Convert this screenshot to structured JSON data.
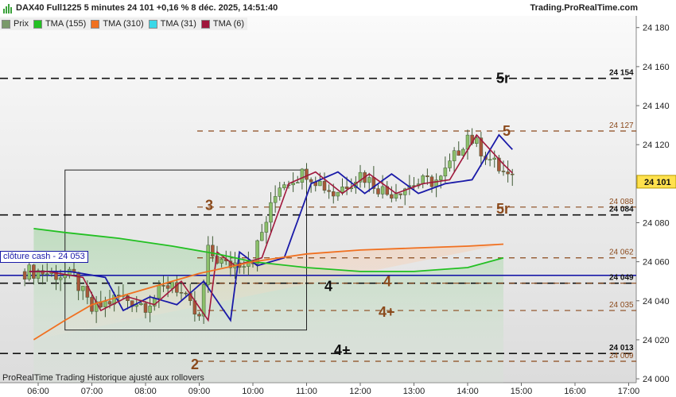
{
  "header": {
    "title": "DAX40 Full1225 5 minutes 24 101 +0,16 % 8 déc. 2025, 14:51:40",
    "site": "Trading.ProRealTime.com"
  },
  "legend": [
    {
      "label": "Prix",
      "color": "#7a9a6a"
    },
    {
      "label": "TMA (155)",
      "color": "#22c022"
    },
    {
      "label": "TMA (310)",
      "color": "#f07020"
    },
    {
      "label": "TMA (31)",
      "color": "#3ad8e8"
    },
    {
      "label": "TMA (6)",
      "color": "#a0183c"
    }
  ],
  "cash_label": "clôture cash -  24 053",
  "footer_note": "ProRealTime Trading  Historique ajusté aux rollovers",
  "chart_data": {
    "type": "candlestick",
    "title": "DAX40 Full1225 5 minutes",
    "x_ticks": [
      "06:00",
      "07:00",
      "08:00",
      "09:00",
      "10:00",
      "11:00",
      "12:00",
      "13:00",
      "14:00",
      "15:00",
      "16:00",
      "17:00"
    ],
    "y_ticks": [
      "24 180",
      "24 160",
      "24 140",
      "24 120",
      "24 100",
      "24 080",
      "24 060",
      "24 040",
      "24 020",
      "24 000"
    ],
    "ylim": [
      23998,
      24186
    ],
    "last_price": {
      "label": "24 101",
      "value": 24101
    },
    "levels": [
      {
        "value": 24154,
        "label": "24 154",
        "tag": "5r",
        "color": "#111111",
        "style": "long-dash",
        "tag_color": "#111111"
      },
      {
        "value": 24127,
        "label": "24 127",
        "tag": "5",
        "color": "#8b4a1c",
        "style": "dash",
        "tag_color": "#8b4a1c"
      },
      {
        "value": 24088,
        "label": "24 088",
        "tag": "5r",
        "color": "#8b4a1c",
        "style": "dash",
        "tag_color": "#8b4a1c"
      },
      {
        "value": 24084,
        "label": "24 084",
        "tag": "3",
        "color": "#111111",
        "style": "long-dash",
        "tag_color": "#8b4a1c"
      },
      {
        "value": 24062,
        "label": "24 062",
        "tag": "",
        "color": "#8b4a1c",
        "style": "dash",
        "tag_color": "#8b4a1c"
      },
      {
        "value": 24053,
        "label": "",
        "tag": "",
        "color": "#1a1aa8",
        "style": "solid",
        "tag_color": "#1a1aa8"
      },
      {
        "value": 24049,
        "label": "24 049",
        "tag": "4",
        "color": "#111111",
        "style": "long-dash",
        "tag_color": "#111111"
      },
      {
        "value": 24049,
        "label": "",
        "tag": "4",
        "color": "#8b4a1c",
        "style": "dash",
        "tag_color": "#8b4a1c"
      },
      {
        "value": 24035,
        "label": "24 035",
        "tag": "4+",
        "color": "#8b4a1c",
        "style": "dash",
        "tag_color": "#8b4a1c"
      },
      {
        "value": 24013,
        "label": "24 013",
        "tag": "4+",
        "color": "#111111",
        "style": "long-dash",
        "tag_color": "#111111"
      },
      {
        "value": 24009,
        "label": "24 009",
        "tag": "2",
        "color": "#8b4a1c",
        "style": "dash",
        "tag_color": "#8b4a1c"
      }
    ],
    "box": {
      "t_start": "06:30",
      "t_end": "11:00",
      "low": 24025,
      "high": 24107
    },
    "series": [
      {
        "name": "Prix",
        "color": "#7a9a6a"
      },
      {
        "name": "TMA (155)",
        "color": "#22c022"
      },
      {
        "name": "TMA (310)",
        "color": "#f07020"
      },
      {
        "name": "TMA (31)",
        "color": "#3ad8e8"
      },
      {
        "name": "TMA (6)",
        "color": "#a0183c"
      }
    ],
    "candles_sample": [
      {
        "t": "06:00",
        "o": 24060,
        "h": 24066,
        "l": 24050,
        "c": 24055
      },
      {
        "t": "06:40",
        "o": 24055,
        "h": 24058,
        "l": 24040,
        "c": 24052
      },
      {
        "t": "07:00",
        "o": 24052,
        "h": 24060,
        "l": 24020,
        "c": 24035
      },
      {
        "t": "07:30",
        "o": 24035,
        "h": 24046,
        "l": 24028,
        "c": 24042
      },
      {
        "t": "08:00",
        "o": 24042,
        "h": 24050,
        "l": 24030,
        "c": 24038
      },
      {
        "t": "08:30",
        "o": 24038,
        "h": 24055,
        "l": 24032,
        "c": 24050
      },
      {
        "t": "09:00",
        "o": 24045,
        "h": 24062,
        "l": 24009,
        "c": 24030
      },
      {
        "t": "09:10",
        "o": 24030,
        "h": 24084,
        "l": 24020,
        "c": 24065
      },
      {
        "t": "09:30",
        "o": 24065,
        "h": 24072,
        "l": 24045,
        "c": 24058
      },
      {
        "t": "10:00",
        "o": 24055,
        "h": 24068,
        "l": 24048,
        "c": 24062
      },
      {
        "t": "10:30",
        "o": 24062,
        "h": 24106,
        "l": 24060,
        "c": 24100
      },
      {
        "t": "11:00",
        "o": 24100,
        "h": 24114,
        "l": 24090,
        "c": 24106
      },
      {
        "t": "11:30",
        "o": 24106,
        "h": 24110,
        "l": 24090,
        "c": 24095
      },
      {
        "t": "12:00",
        "o": 24095,
        "h": 24110,
        "l": 24088,
        "c": 24105
      },
      {
        "t": "12:30",
        "o": 24105,
        "h": 24112,
        "l": 24085,
        "c": 24095
      },
      {
        "t": "13:00",
        "o": 24095,
        "h": 24104,
        "l": 24088,
        "c": 24100
      },
      {
        "t": "13:30",
        "o": 24100,
        "h": 24106,
        "l": 24088,
        "c": 24102
      },
      {
        "t": "14:00",
        "o": 24102,
        "h": 24135,
        "l": 24098,
        "c": 24125
      },
      {
        "t": "14:30",
        "o": 24125,
        "h": 24130,
        "l": 24105,
        "c": 24110
      },
      {
        "t": "14:50",
        "o": 24110,
        "h": 24112,
        "l": 24098,
        "c": 24101
      }
    ]
  }
}
